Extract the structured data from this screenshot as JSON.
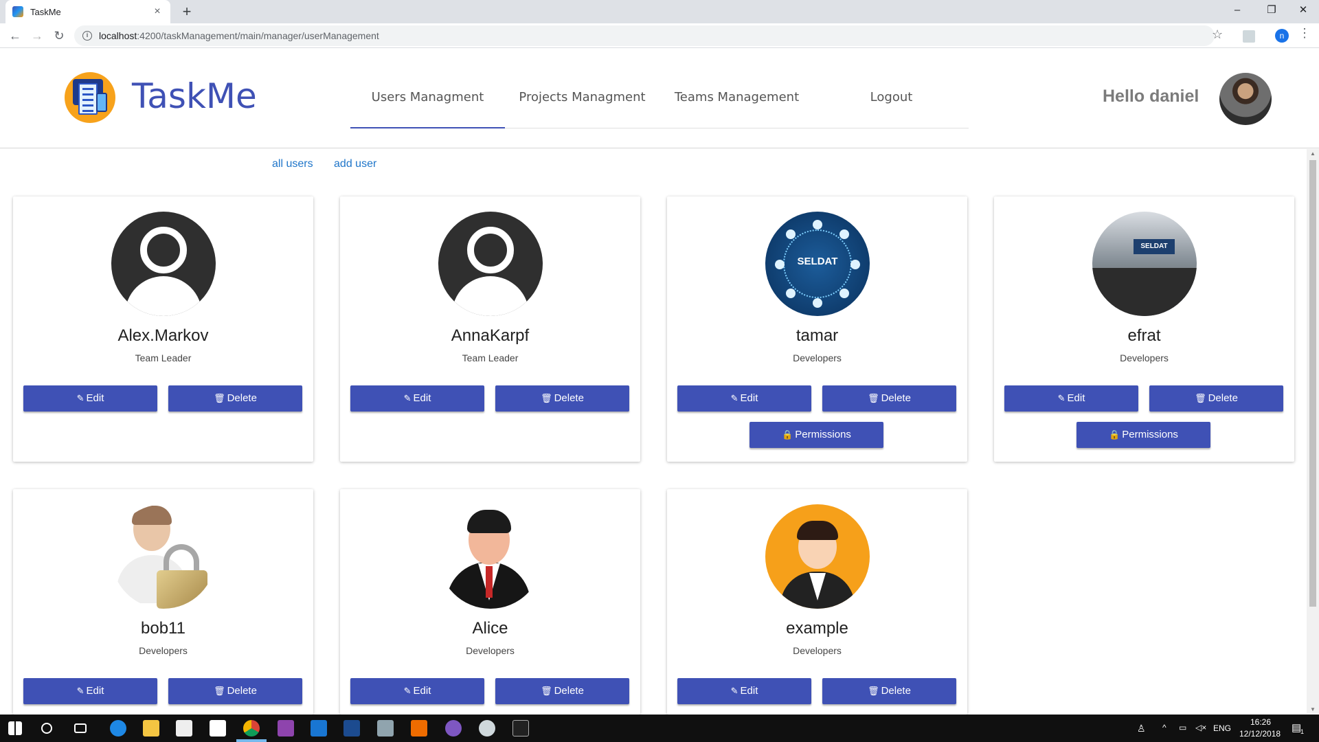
{
  "browser": {
    "tab_title": "TaskMe",
    "tab_close": "×",
    "new_tab": "+",
    "url_host": "localhost",
    "url_path": ":4200/taskManagement/main/manager/userManagement",
    "profile_initial": "n",
    "window_controls": {
      "minimize": "–",
      "maximize": "❐",
      "close": "✕"
    }
  },
  "header": {
    "brand": "TaskMe",
    "nav": [
      {
        "label": "Users Managment",
        "active": true
      },
      {
        "label": "Projects Managment",
        "active": false
      },
      {
        "label": "Teams Management",
        "active": false
      },
      {
        "label": "Logout",
        "active": false
      }
    ],
    "greeting": "Hello daniel"
  },
  "subnav": {
    "all_users": "all users",
    "add_user": "add user"
  },
  "buttons": {
    "edit": "Edit",
    "delete": "Delete",
    "permissions": "Permissions"
  },
  "users": [
    {
      "name": "Alex.Markov",
      "role": "Team Leader",
      "picture": "default-avatar-icon",
      "permissions": false
    },
    {
      "name": "AnnaKarpf",
      "role": "Team Leader",
      "picture": "default-avatar-icon",
      "permissions": false
    },
    {
      "name": "tamar",
      "role": "Developers",
      "picture": "seldat-logo-image",
      "permissions": true
    },
    {
      "name": "efrat",
      "role": "Developers",
      "picture": "exhibition-photo",
      "permissions": true
    },
    {
      "name": "bob11",
      "role": "Developers",
      "picture": "user-lock-icon",
      "permissions": false
    },
    {
      "name": "Alice",
      "role": "Developers",
      "picture": "businessman-icon",
      "permissions": false
    },
    {
      "name": "example",
      "role": "Developers",
      "picture": "orange-businessman-icon",
      "permissions": false
    }
  ],
  "pictures": {
    "seldat_text": "SELDAT",
    "booth_sign": "SELDAT"
  },
  "taskbar": {
    "language": "ENG",
    "time": "16:26",
    "date": "12/12/2018",
    "notifications": "1"
  },
  "colors": {
    "primary": "#3f51b5",
    "link": "#1e75c9",
    "accent": "#f7a21b"
  }
}
